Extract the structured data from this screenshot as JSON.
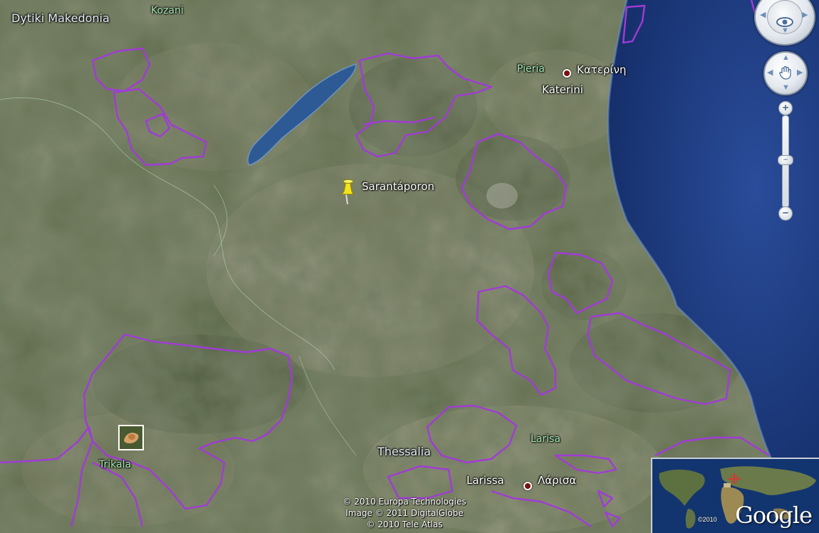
{
  "map": {
    "labels": {
      "dytiki_makedonia": "Dytiki Makedonia",
      "kozani": "Kozani",
      "pieria": "Pieria",
      "katerini_greek": "Κατερίνη",
      "katerini": "Katerini",
      "sarantaporon": "Sarantáporon",
      "thessalia": "Thessalia",
      "larisa": "Larisa",
      "larissa": "Larissa",
      "larissa_greek": "Λάρισα",
      "trikala": "Trikala"
    },
    "copyright": {
      "line1": "© 2010 Europa Technologies",
      "line2": "Image © 2011 DigitalGlobe",
      "line3": "© 2010 Tele Atlas"
    },
    "placemark_icon": "yellow-pushpin-icon",
    "colors": {
      "boundary": "#a13bd6",
      "sea": "#1d3f86",
      "land": "#4e5b3c"
    }
  },
  "controls": {
    "look_icon": "eye-icon",
    "move_icon": "hand-icon",
    "zoom_in": "+",
    "zoom_out": "−"
  },
  "inset": {
    "logo": "Google",
    "copyright": "©2010"
  }
}
